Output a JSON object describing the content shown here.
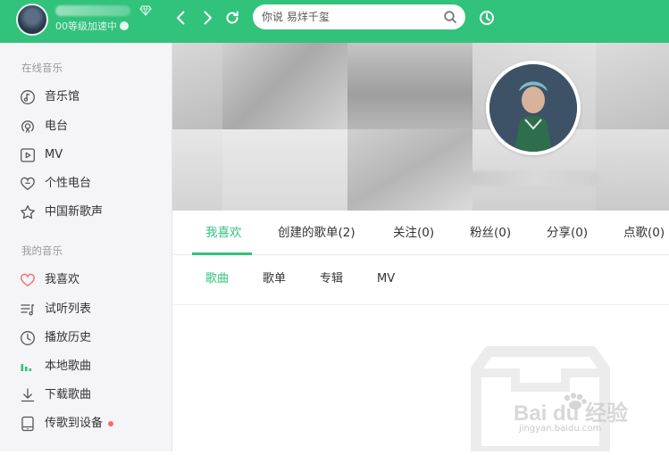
{
  "header": {
    "level_text": "00等级加速中",
    "search_text": "你说 易烊千玺",
    "icons": [
      "back-icon",
      "forward-icon",
      "refresh-icon",
      "search-icon",
      "listen-recognize-icon",
      "diamond-icon"
    ]
  },
  "sidebar": {
    "online_title": "在线音乐",
    "online_items": [
      {
        "label": "音乐馆",
        "icon": "music-hall-icon"
      },
      {
        "label": "电台",
        "icon": "radio-icon"
      },
      {
        "label": "MV",
        "icon": "mv-icon"
      },
      {
        "label": "个性电台",
        "icon": "heart-radio-icon"
      },
      {
        "label": "中国新歌声",
        "icon": "star-icon"
      }
    ],
    "mine_title": "我的音乐",
    "mine_items": [
      {
        "label": "我喜欢",
        "icon": "heart-icon"
      },
      {
        "label": "试听列表",
        "icon": "playlist-icon"
      },
      {
        "label": "播放历史",
        "icon": "clock-icon"
      },
      {
        "label": "本地歌曲",
        "icon": "local-bars-icon"
      },
      {
        "label": "下载歌曲",
        "icon": "download-icon"
      },
      {
        "label": "传歌到设备",
        "icon": "device-icon"
      }
    ]
  },
  "tabs": [
    {
      "label": "我喜欢",
      "active": true
    },
    {
      "label": "创建的歌单(2)"
    },
    {
      "label": "关注(0)"
    },
    {
      "label": "粉丝(0)"
    },
    {
      "label": "分享(0)"
    },
    {
      "label": "点歌(0)"
    }
  ],
  "subtabs": [
    {
      "label": "歌曲",
      "active": true
    },
    {
      "label": "歌单"
    },
    {
      "label": "专辑"
    },
    {
      "label": "MV"
    }
  ],
  "watermark": {
    "text": "Bai du 经验",
    "sub": "jingyan.baidu.com"
  },
  "colors": {
    "accent": "#31c27c",
    "sidebar_bg": "#f5f5f7",
    "heart": "#f26b6b"
  }
}
